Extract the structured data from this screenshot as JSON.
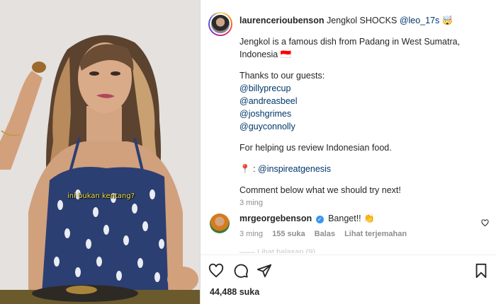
{
  "video": {
    "subtitle": "ini bukan kentang?"
  },
  "post": {
    "username": "laurencerioubenson",
    "title_text": "Jengkol SHOCKS",
    "title_mention": "@leo_17s",
    "title_emoji": "🤯",
    "description": "Jengkol is a famous dish from Padang in West Sumatra, Indonesia",
    "description_flag": "🇮🇩",
    "thanks_line": "Thanks to our guests:",
    "guests": [
      "@billyprecup",
      "@andreasbeel",
      "@joshgrimes",
      "@guyconnolly"
    ],
    "helping_line": "For helping us review Indonesian food.",
    "location_pin": "📍",
    "location_sep": ":",
    "location_mention": "@inspireatgenesis",
    "cta_line": "Comment below what we should try next!",
    "time": "3 ming"
  },
  "comment": {
    "username": "mrgeorgebenson",
    "verified_mark": "✓",
    "text": "Banget!!",
    "emoji": "👏",
    "time": "3 ming",
    "likes": "155 suka",
    "reply_label": "Balas",
    "translate_label": "Lihat terjemahan"
  },
  "more_comments_text": "—— Lihat balasan (9)",
  "actions": {
    "like_icon": "heart-icon",
    "comment_icon": "comment-icon",
    "share_icon": "share-icon",
    "save_icon": "bookmark-icon"
  },
  "likes_count": "44,488",
  "likes_suffix": "suka"
}
